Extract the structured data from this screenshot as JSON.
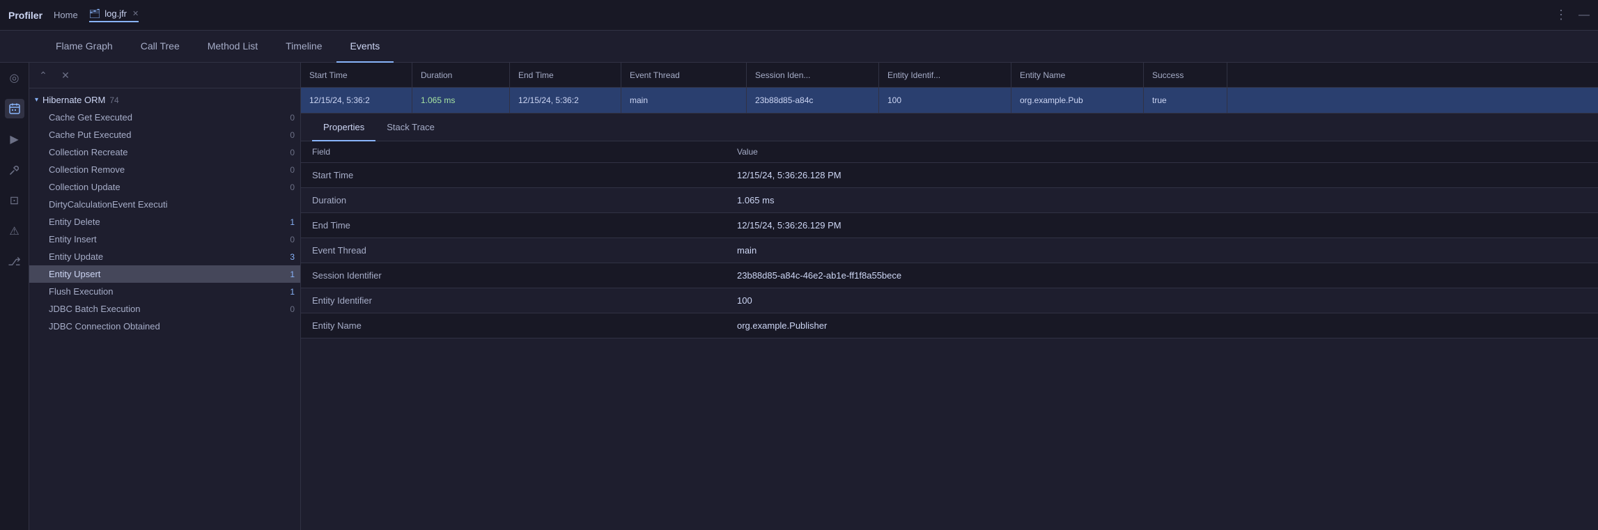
{
  "titleBar": {
    "appName": "Profiler",
    "homeLabel": "Home",
    "tabLabel": "log.jfr",
    "tabCloseIcon": "✕",
    "folderIcon": "📁",
    "menuIcon": "⋮",
    "minimizeIcon": "—"
  },
  "navTabs": [
    {
      "label": "Flame Graph",
      "active": false
    },
    {
      "label": "Call Tree",
      "active": false
    },
    {
      "label": "Method List",
      "active": false
    },
    {
      "label": "Timeline",
      "active": false
    },
    {
      "label": "Events",
      "active": true
    }
  ],
  "railIcons": [
    {
      "name": "target-icon",
      "symbol": "◎",
      "active": false
    },
    {
      "name": "calendar-icon",
      "symbol": "📅",
      "active": true
    },
    {
      "name": "play-icon",
      "symbol": "▶",
      "active": false
    },
    {
      "name": "tools-icon",
      "symbol": "🔧",
      "active": false
    },
    {
      "name": "terminal-icon",
      "symbol": "⊡",
      "active": false
    },
    {
      "name": "alert-icon",
      "symbol": "⚠",
      "active": false
    },
    {
      "name": "git-icon",
      "symbol": "⎇",
      "active": false
    }
  ],
  "sidebar": {
    "collapseIcon": "⌃",
    "closeIcon": "✕",
    "groupLabel": "Hibernate ORM",
    "groupCount": "74",
    "items": [
      {
        "label": "Cache Get Executed",
        "count": "0",
        "hasData": false,
        "selected": false
      },
      {
        "label": "Cache Put Executed",
        "count": "0",
        "hasData": false,
        "selected": false
      },
      {
        "label": "Collection Recreate",
        "count": "0",
        "hasData": false,
        "selected": false
      },
      {
        "label": "Collection Remove",
        "count": "0",
        "hasData": false,
        "selected": false
      },
      {
        "label": "Collection Update",
        "count": "0",
        "hasData": false,
        "selected": false
      },
      {
        "label": "DirtyCalculationEvent Executi",
        "count": "",
        "hasData": false,
        "selected": false
      },
      {
        "label": "Entity Delete",
        "count": "1",
        "hasData": true,
        "selected": false
      },
      {
        "label": "Entity Insert",
        "count": "0",
        "hasData": false,
        "selected": false
      },
      {
        "label": "Entity Update",
        "count": "3",
        "hasData": true,
        "selected": false
      },
      {
        "label": "Entity Upsert",
        "count": "1",
        "hasData": true,
        "selected": true
      },
      {
        "label": "Flush Execution",
        "count": "1",
        "hasData": true,
        "selected": false
      },
      {
        "label": "JDBC Batch Execution",
        "count": "0",
        "hasData": false,
        "selected": false
      },
      {
        "label": "JDBC Connection Obtained",
        "count": "",
        "hasData": false,
        "selected": false
      }
    ]
  },
  "eventsTable": {
    "columns": [
      {
        "label": "Start Time",
        "key": "startTime"
      },
      {
        "label": "Duration",
        "key": "duration"
      },
      {
        "label": "End Time",
        "key": "endTime"
      },
      {
        "label": "Event Thread",
        "key": "eventThread"
      },
      {
        "label": "Session Iden...",
        "key": "sessionIden"
      },
      {
        "label": "Entity Identif...",
        "key": "entityIdentif"
      },
      {
        "label": "Entity Name",
        "key": "entityName"
      },
      {
        "label": "Success",
        "key": "success"
      }
    ],
    "rows": [
      {
        "startTime": "12/15/24, 5:36:2",
        "duration": "1.065 ms",
        "endTime": "12/15/24, 5:36:2",
        "eventThread": "main",
        "sessionIden": "23b88d85-a84c",
        "entityIdentif": "100",
        "entityName": "org.example.Pub",
        "success": "true",
        "selected": true
      }
    ]
  },
  "detailPanel": {
    "tabs": [
      {
        "label": "Properties",
        "active": true
      },
      {
        "label": "Stack Trace",
        "active": false
      }
    ],
    "columnHeaders": {
      "field": "Field",
      "value": "Value"
    },
    "rows": [
      {
        "field": "Start Time",
        "value": "12/15/24, 5:36:26.128 PM"
      },
      {
        "field": "Duration",
        "value": "1.065 ms"
      },
      {
        "field": "End Time",
        "value": "12/15/24, 5:36:26.129 PM"
      },
      {
        "field": "Event Thread",
        "value": "main"
      },
      {
        "field": "Session Identifier",
        "value": "23b88d85-a84c-46e2-ab1e-ff1f8a55bece"
      },
      {
        "field": "Entity Identifier",
        "value": "100"
      },
      {
        "field": "Entity Name",
        "value": "org.example.Publisher"
      }
    ]
  }
}
